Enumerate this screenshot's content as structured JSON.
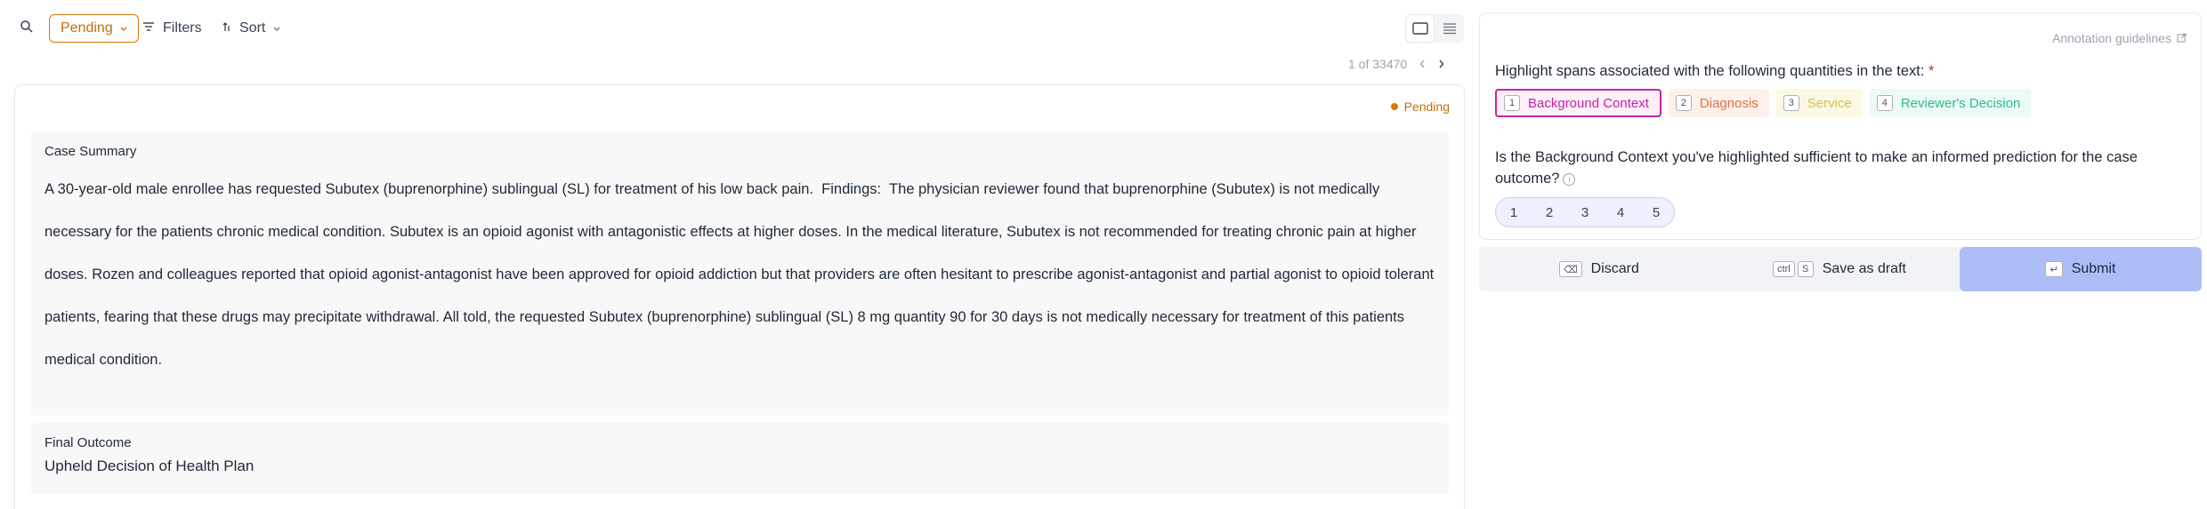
{
  "toolbar": {
    "status_filter": "Pending",
    "filters_label": "Filters",
    "sort_label": "Sort"
  },
  "pager": {
    "text": "1 of 33470"
  },
  "record": {
    "status": "Pending",
    "summary_label": "Case Summary",
    "summary_text": "A 30-year-old male enrollee has requested Subutex (buprenorphine) sublingual (SL) for treatment of his low back pain.  Findings:  The physician reviewer found that buprenorphine (Subutex) is not medically necessary for the patients chronic medical condition. Subutex is an opioid agonist with antagonistic effects at higher doses. In the medical literature, Subutex is not recommended for treating chronic pain at higher doses. Rozen and colleagues reported that opioid agonist-antagonist have been approved for opioid addiction but that providers are often hesitant to prescribe agonist-antagonist and partial agonist to opioid tolerant patients, fearing that these drugs may precipitate withdrawal. All told, the requested Subutex (buprenorphine) sublingual (SL) 8 mg quantity 90 for 30 days is not medically necessary for treatment of this patients medical condition.",
    "outcome_label": "Final Outcome",
    "outcome_text": "Upheld Decision of Health Plan"
  },
  "annotation": {
    "guidelines_label": "Annotation guidelines",
    "question1": "Highlight spans associated with the following quantities in the text:",
    "required_mark": "*",
    "labels": [
      {
        "key": "1",
        "text": "Background Context",
        "color": "#c026a3"
      },
      {
        "key": "2",
        "text": "Diagnosis",
        "color": "#e0703f"
      },
      {
        "key": "3",
        "text": "Service",
        "color": "#d4c24f"
      },
      {
        "key": "4",
        "text": "Reviewer's Decision",
        "color": "#34b98a"
      }
    ],
    "question2": "Is the Background Context you've highlighted sufficient to make an informed prediction for the case outcome?",
    "rating_options": [
      "1",
      "2",
      "3",
      "4",
      "5"
    ]
  },
  "actions": {
    "discard_label": "Discard",
    "discard_key": "⌫",
    "draft_label": "Save as draft",
    "draft_keys": [
      "ctrl",
      "S"
    ],
    "submit_label": "Submit",
    "submit_key": "↵",
    "submit_color": "#aebdf7"
  }
}
